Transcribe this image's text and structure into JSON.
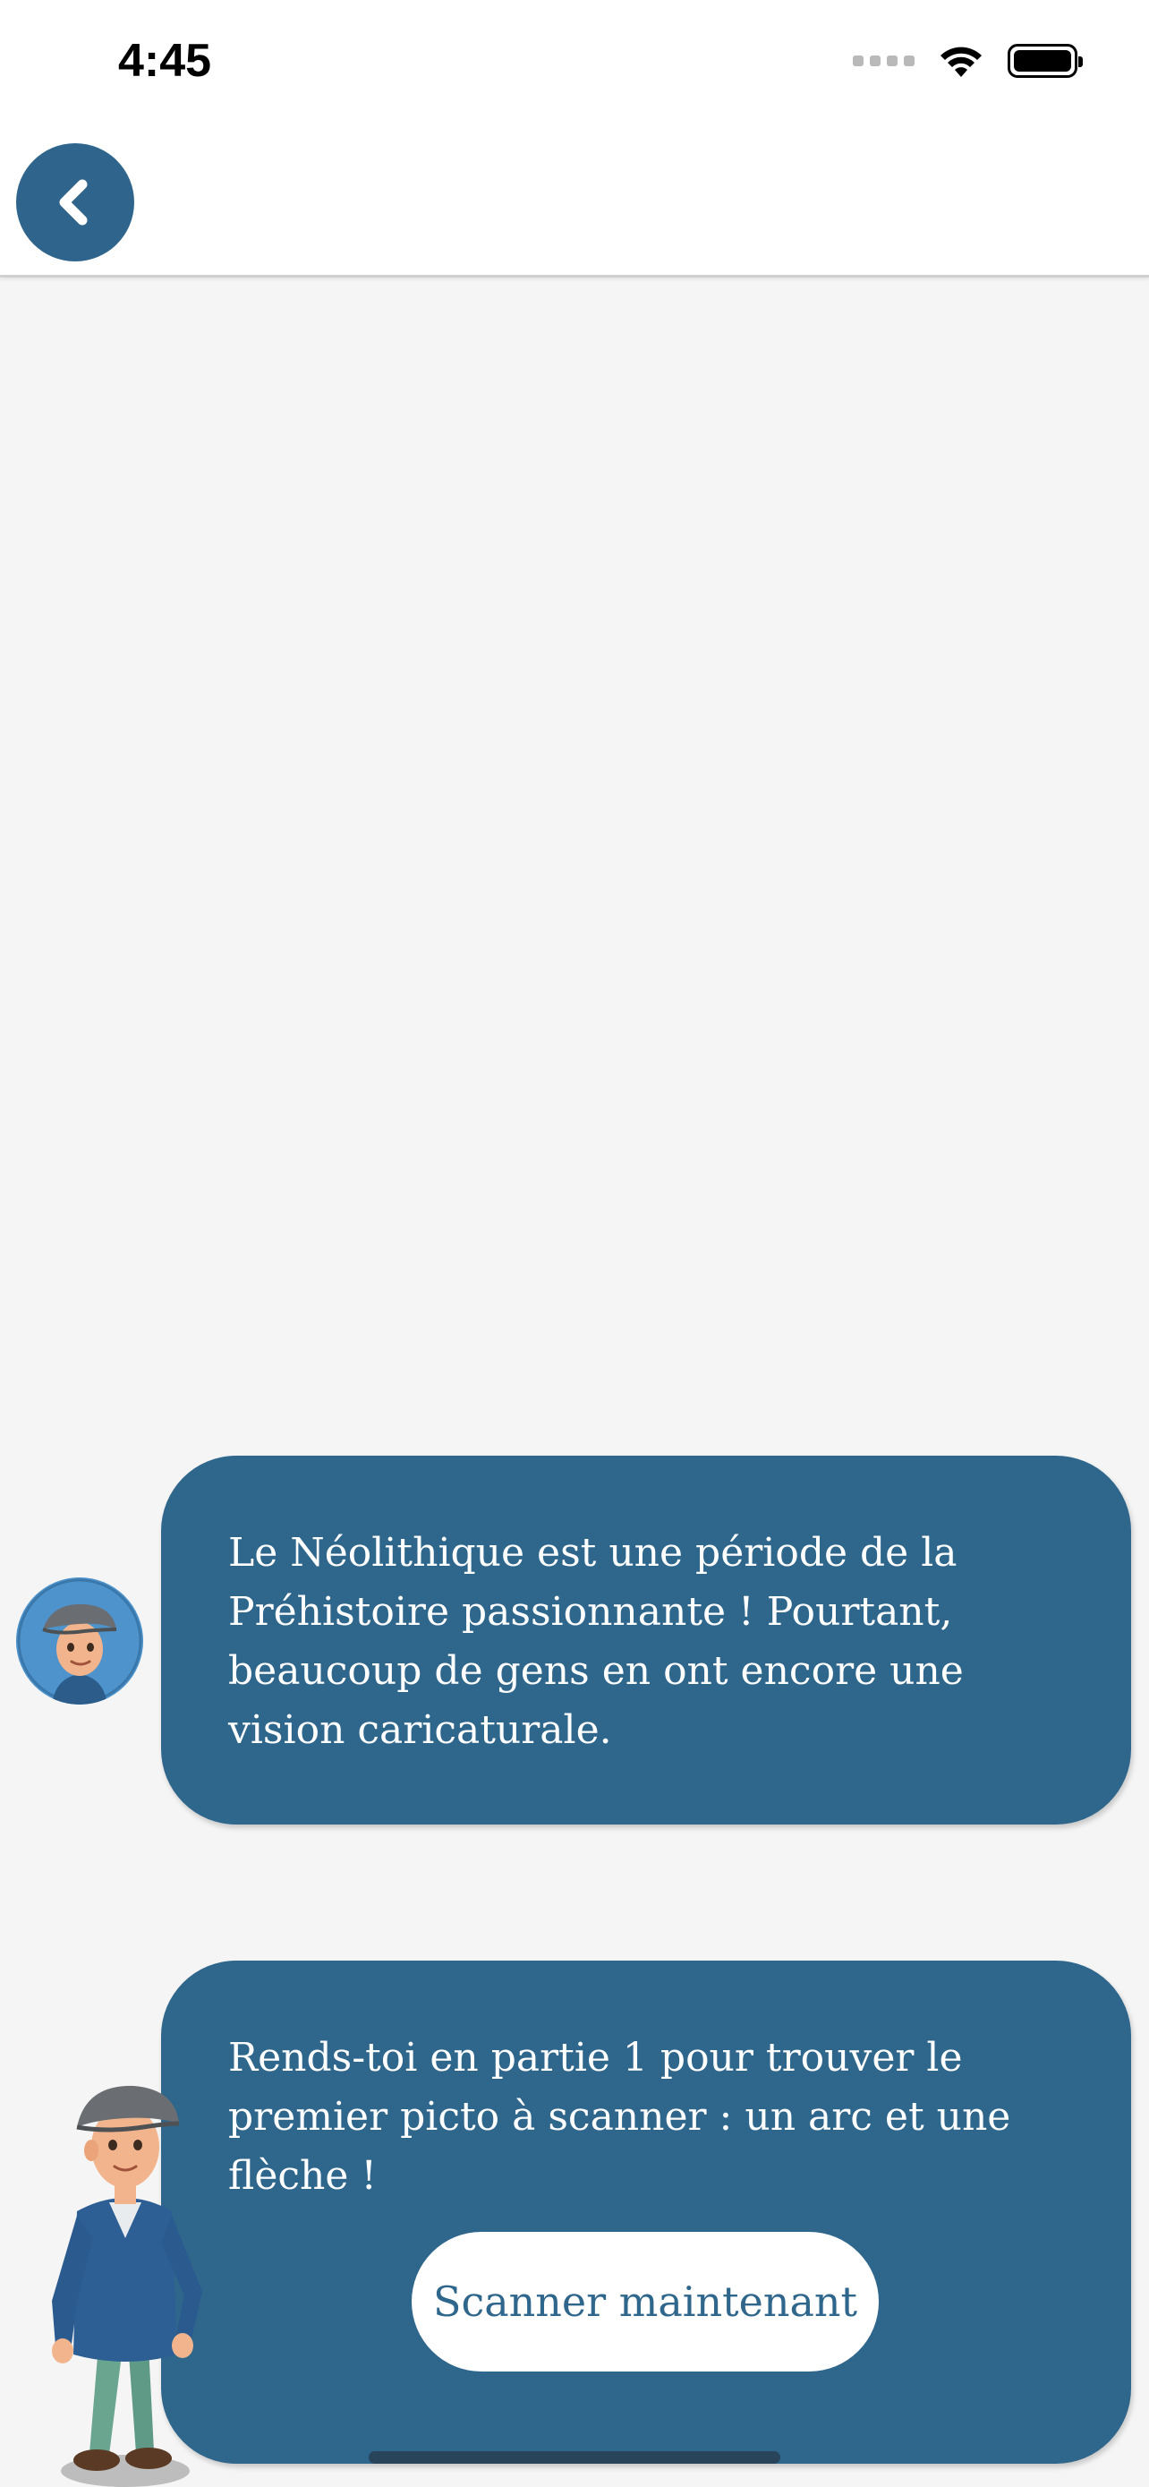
{
  "status_bar": {
    "time": "4:45"
  },
  "nav": {
    "back_icon": "chevron-left-icon"
  },
  "chat": {
    "messages": [
      {
        "text": "Le Néolithique est une période de la Préhistoire passionnante ! Pourtant, beaucoup de gens en ont encore une vision caricaturale."
      },
      {
        "text": "Rends-toi en partie 1 pour trouver le premier picto à scanner : un arc et une flèche !",
        "button_label": "Scanner maintenant"
      }
    ]
  },
  "colors": {
    "primary": "#2f668c",
    "background": "#f5f5f5",
    "button_bg": "#ffffff"
  }
}
